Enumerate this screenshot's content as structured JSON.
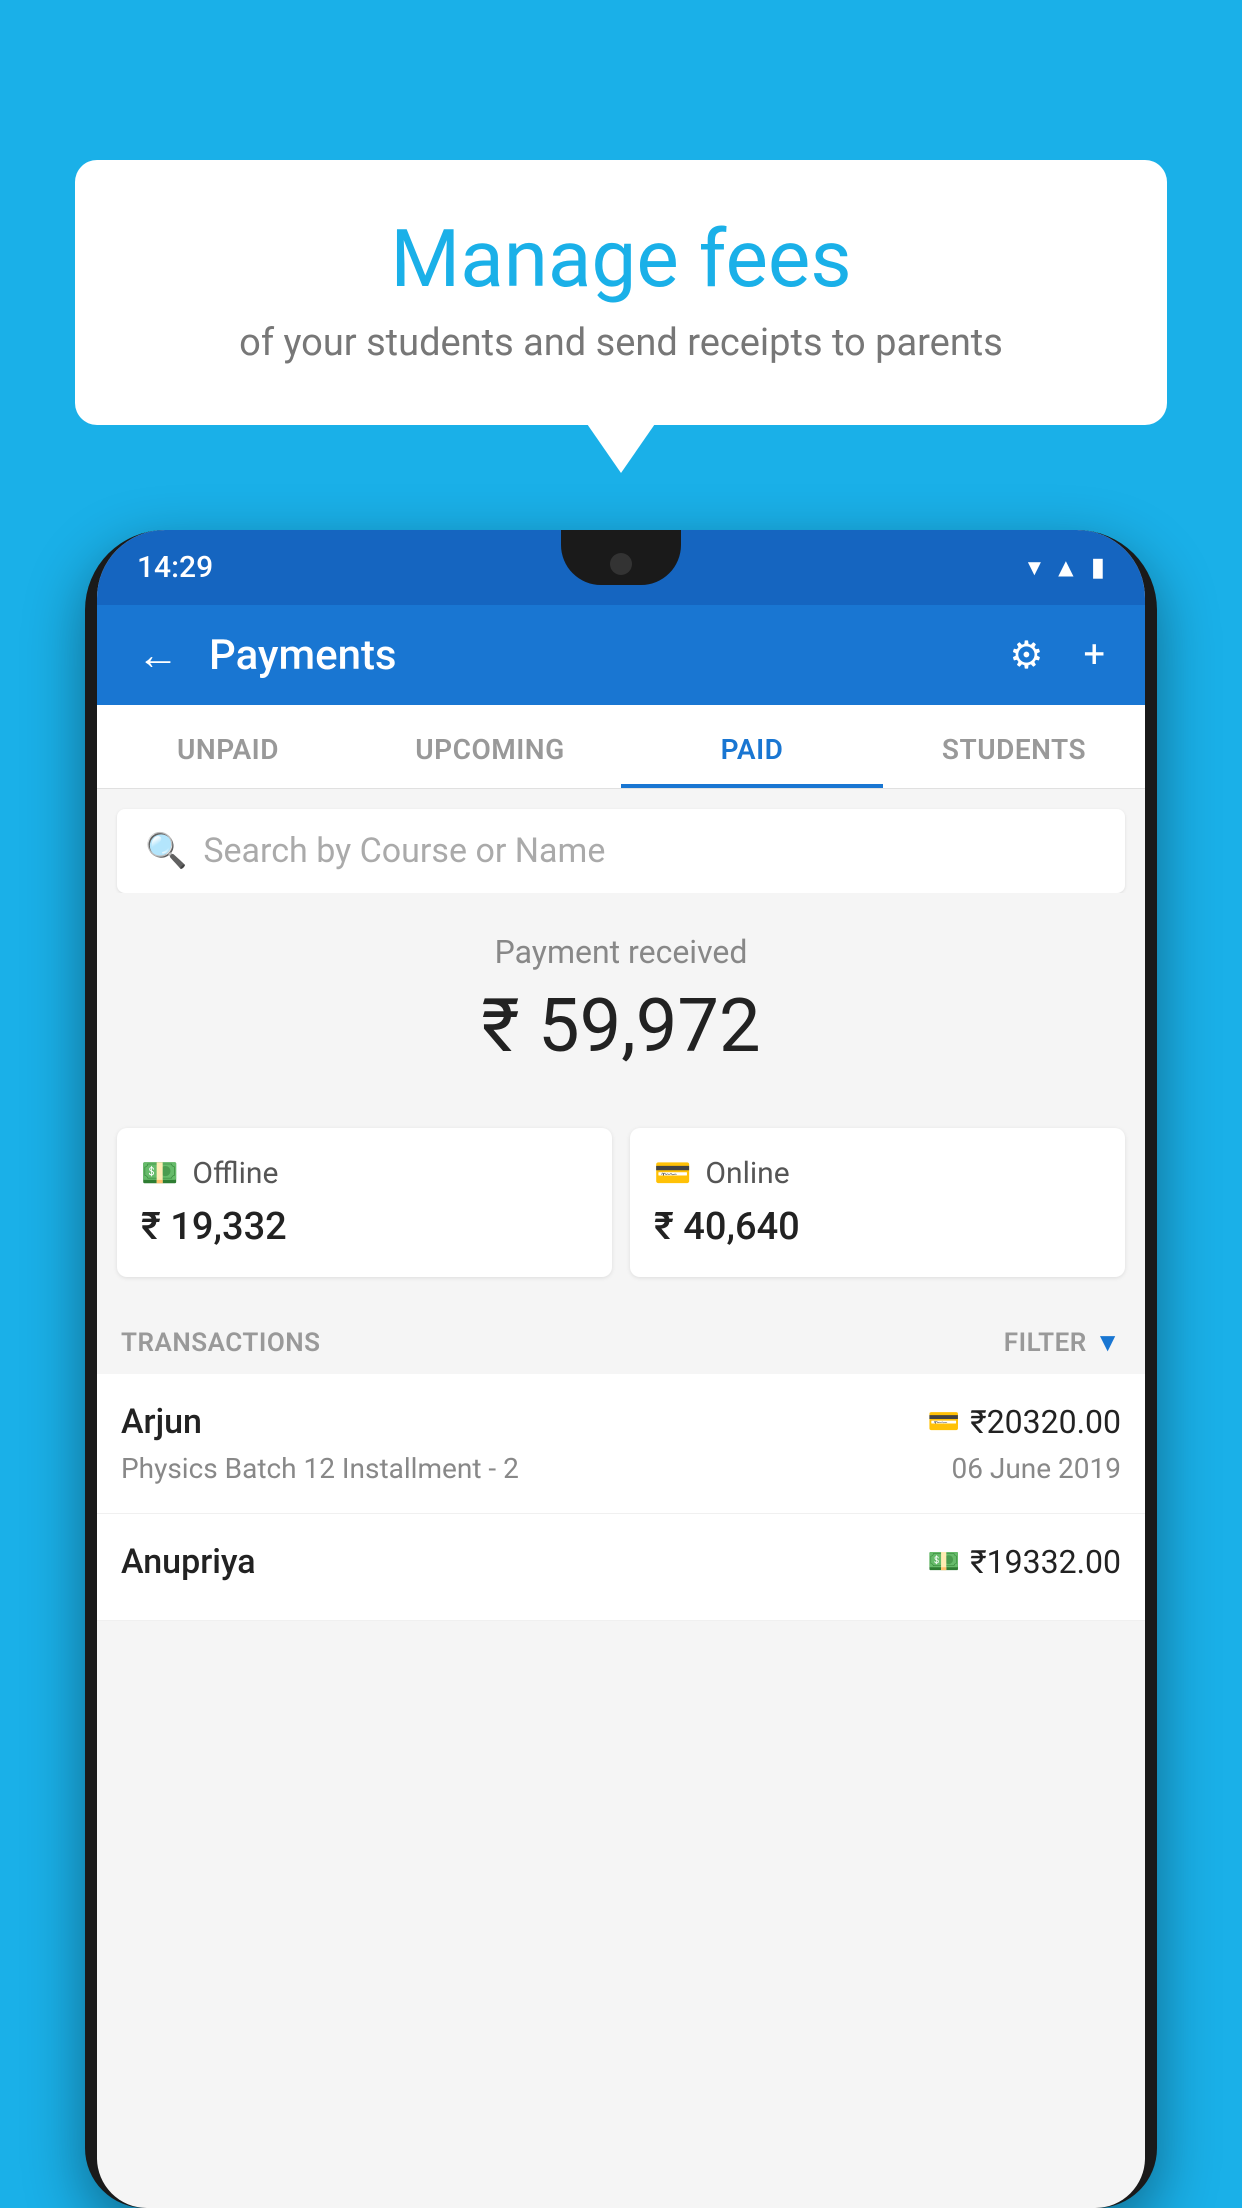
{
  "background_color": "#1ab0e8",
  "bubble": {
    "title": "Manage fees",
    "subtitle": "of your students and send receipts to parents"
  },
  "status_bar": {
    "time": "14:29",
    "icons": [
      "wifi",
      "signal",
      "battery"
    ]
  },
  "toolbar": {
    "back_label": "←",
    "title": "Payments",
    "settings_icon": "⚙",
    "add_icon": "+"
  },
  "tabs": [
    {
      "label": "UNPAID",
      "active": false
    },
    {
      "label": "UPCOMING",
      "active": false
    },
    {
      "label": "PAID",
      "active": true
    },
    {
      "label": "STUDENTS",
      "active": false
    }
  ],
  "search": {
    "placeholder": "Search by Course or Name"
  },
  "payment_summary": {
    "label": "Payment received",
    "total": "₹ 59,972",
    "offline": {
      "label": "Offline",
      "amount": "₹ 19,332"
    },
    "online": {
      "label": "Online",
      "amount": "₹ 40,640"
    }
  },
  "transactions": {
    "section_label": "TRANSACTIONS",
    "filter_label": "FILTER",
    "items": [
      {
        "name": "Arjun",
        "amount": "₹20320.00",
        "course": "Physics Batch 12 Installment - 2",
        "date": "06 June 2019",
        "payment_type": "card"
      },
      {
        "name": "Anupriya",
        "amount": "₹19332.00",
        "course": "",
        "date": "",
        "payment_type": "cash"
      }
    ]
  }
}
